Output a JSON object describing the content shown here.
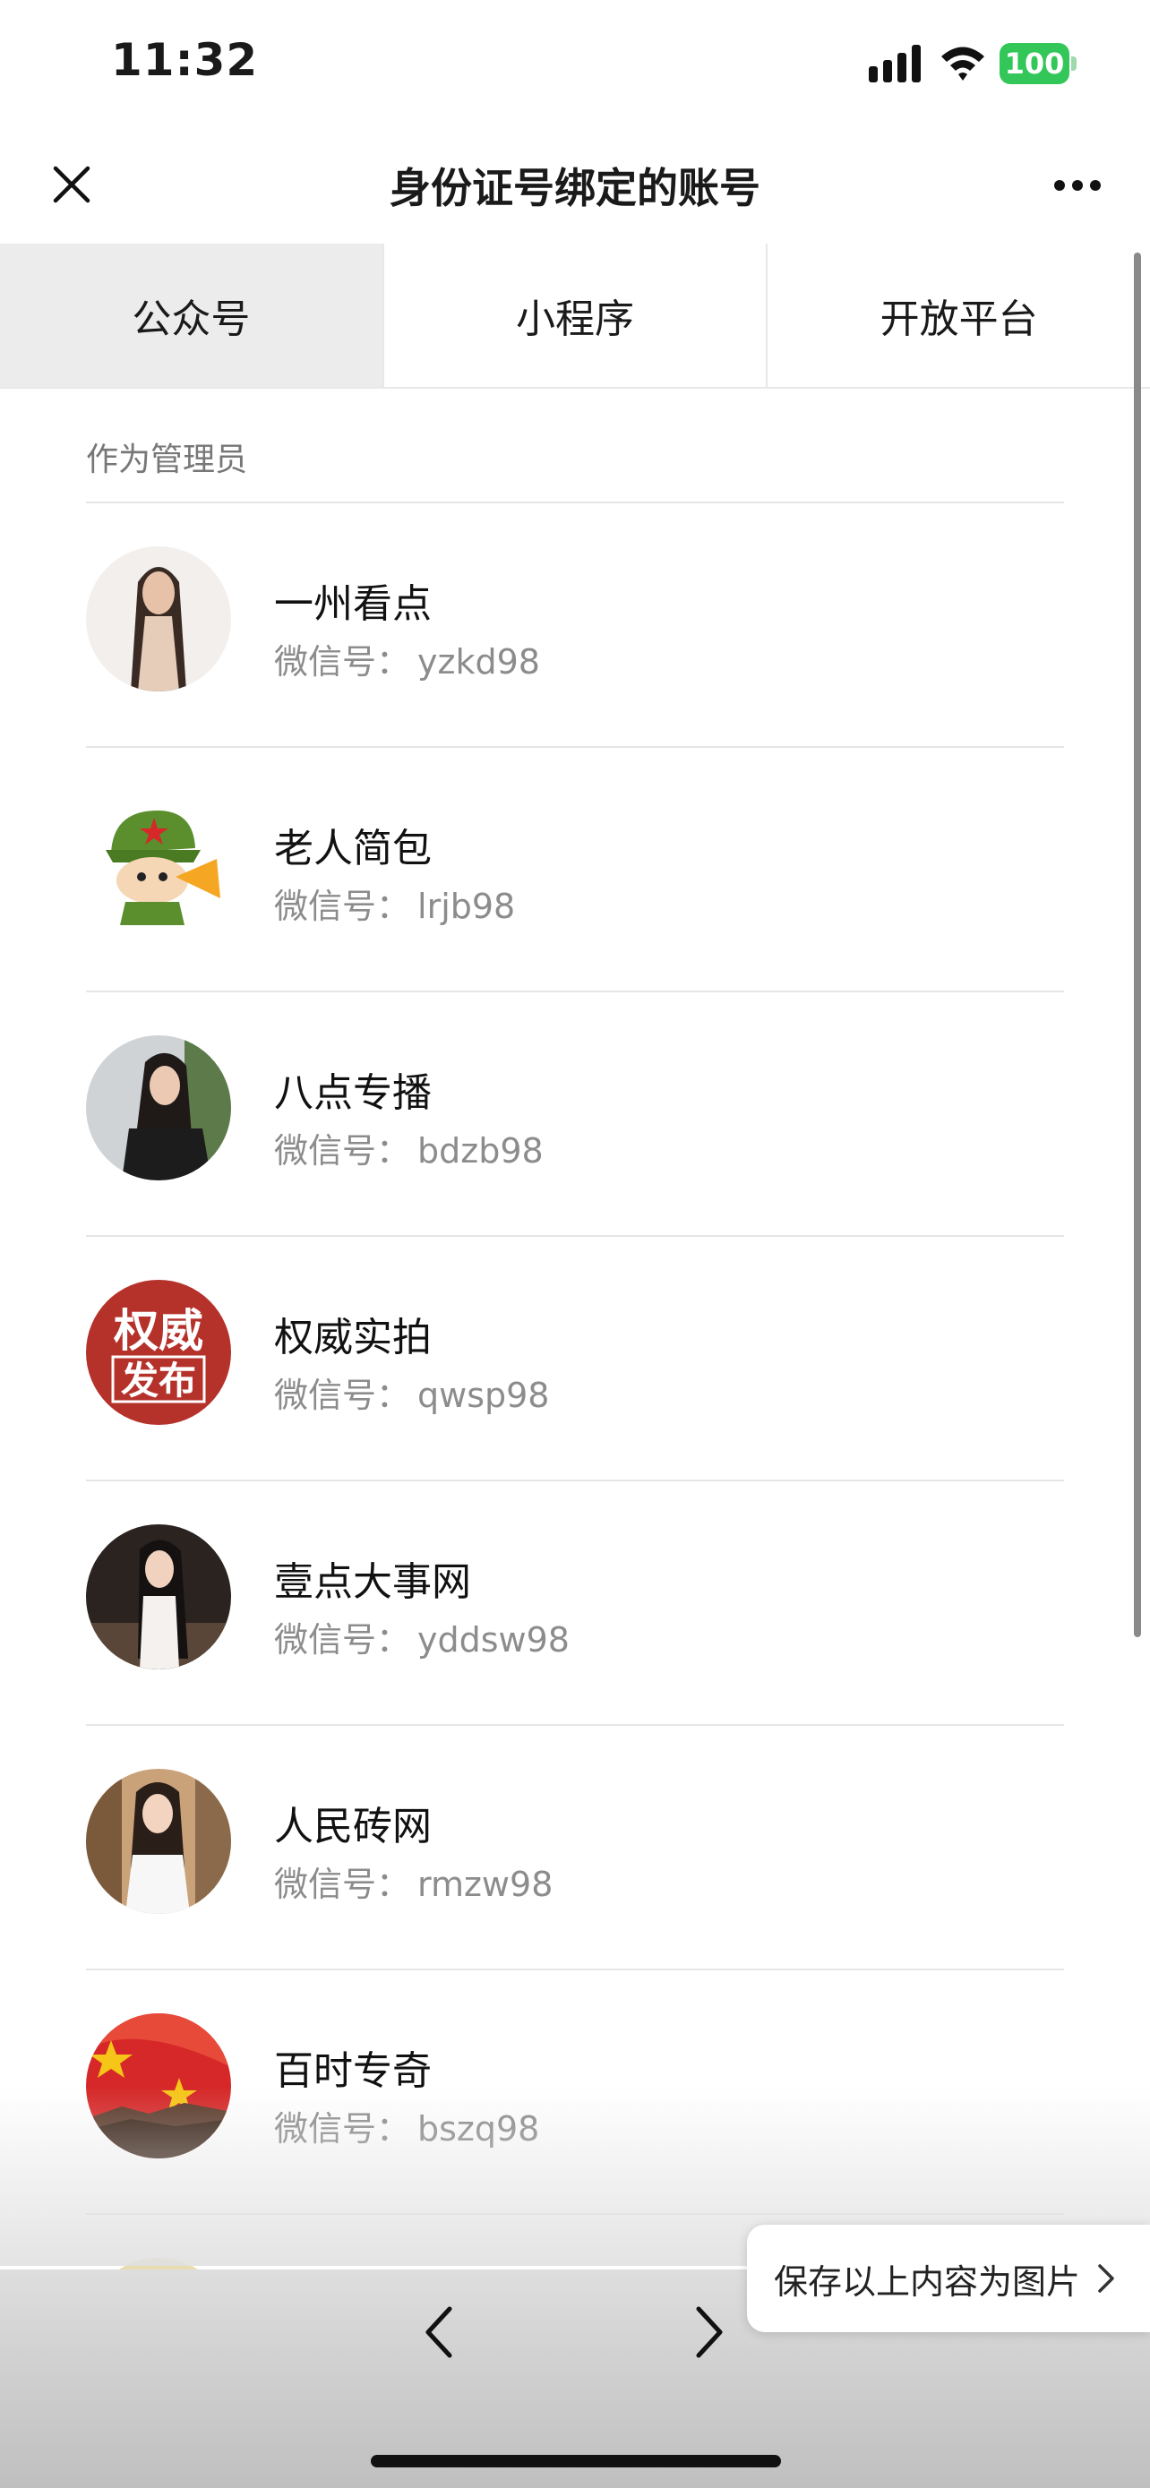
{
  "status_bar": {
    "time": "11:32",
    "battery": "100"
  },
  "nav": {
    "title": "身份证号绑定的账号"
  },
  "tabs": [
    {
      "label": "公众号",
      "active": true
    },
    {
      "label": "小程序",
      "active": false
    },
    {
      "label": "开放平台",
      "active": false
    }
  ],
  "section": {
    "header": "作为管理员"
  },
  "id_prefix": "微信号：",
  "accounts": [
    {
      "name": "一州看点",
      "wechat_id": "yzkd98",
      "avatar": "woman-portrait"
    },
    {
      "name": "老人简包",
      "wechat_id": "lrjb98",
      "avatar": "cartoon-soldier"
    },
    {
      "name": "八点专播",
      "wechat_id": "bdzb98",
      "avatar": "woman-portrait"
    },
    {
      "name": "权威实拍",
      "wechat_id": "qwsp98",
      "avatar": "text-logo",
      "logo_text": [
        "权威",
        "发布"
      ]
    },
    {
      "name": "壹点大事网",
      "wechat_id": "yddsw98",
      "avatar": "woman-portrait"
    },
    {
      "name": "人民砖网",
      "wechat_id": "rmzw98",
      "avatar": "woman-portrait"
    },
    {
      "name": "百时专奇",
      "wechat_id": "bszq98",
      "avatar": "flag-great-wall"
    }
  ],
  "bottom": {
    "save_label": "保存以上内容为图片"
  },
  "colors": {
    "battery": "#33c759",
    "logo_red": "#b5322b",
    "flag_red": "#d62828",
    "star_yellow": "#f5c518"
  }
}
